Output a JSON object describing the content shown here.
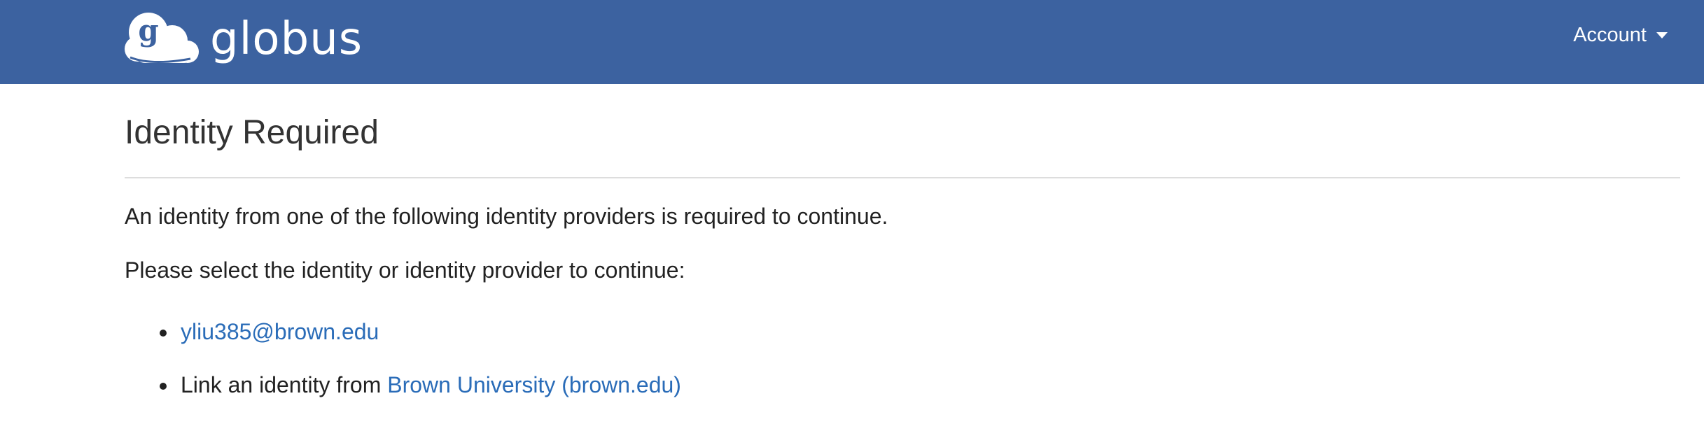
{
  "header": {
    "brand_name": "globus",
    "logo_letter": "g",
    "account_label": "Account",
    "background_color": "#3c62a0"
  },
  "main": {
    "title": "Identity Required",
    "intro_text": "An identity from one of the following identity providers is required to continue.",
    "select_prompt": "Please select the identity or identity provider to continue:",
    "options": [
      {
        "link_text": "yliu385@brown.edu"
      },
      {
        "prefix": "Link an identity from ",
        "link_text": "Brown University (brown.edu)"
      }
    ],
    "link_color": "#2a6cb8"
  }
}
